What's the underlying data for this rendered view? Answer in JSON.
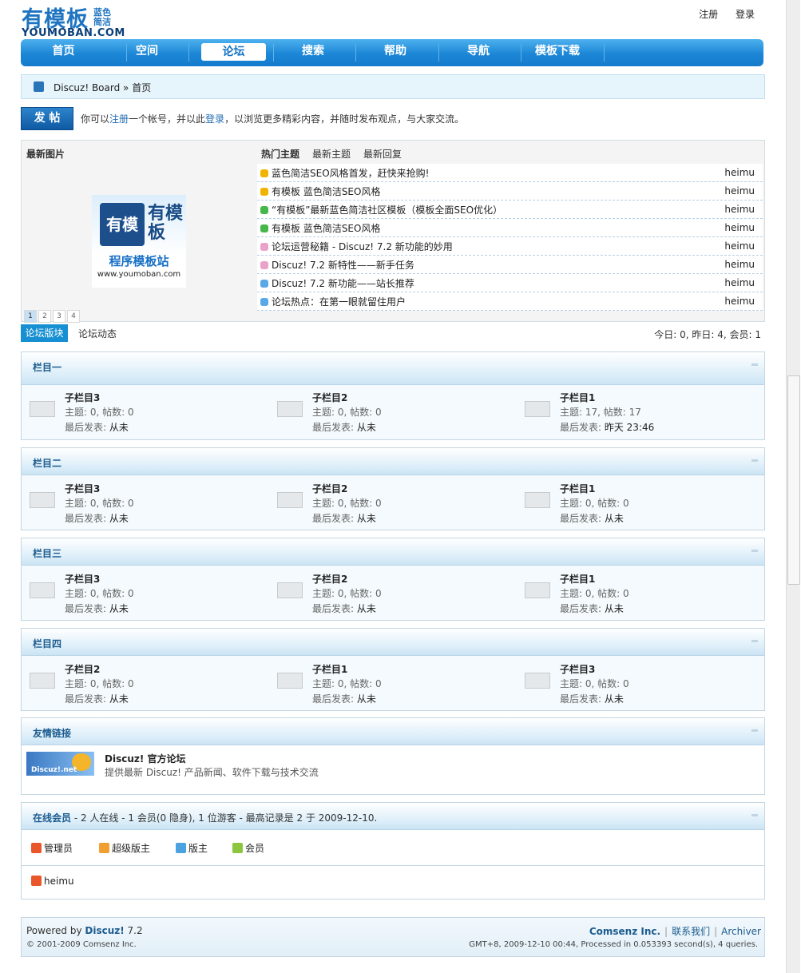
{
  "header": {
    "logo_cn": "有模板",
    "logo_sub1": "蓝色",
    "logo_sub2": "简洁",
    "logo_en": "YOUMOBAN.COM",
    "register": "注册",
    "login": "登录"
  },
  "nav": [
    "首页",
    "空间",
    "论坛",
    "搜索",
    "帮助",
    "导航",
    "模板下载"
  ],
  "nav_active": "论坛",
  "breadcrumb": "Discuz! Board » 首页",
  "post_button": "发 帖",
  "intro": {
    "pre": "你可以",
    "reg": "注册",
    "mid": "一个帐号，并以此",
    "login": "登录",
    "post": "，以浏览更多精彩内容，并随时发布观点，与大家交流。"
  },
  "latest_pics": {
    "title": "最新图片",
    "image_cube": "有模板",
    "image_big": "有模板",
    "image_caption": "程序模板站",
    "image_url": "www.youmoban.com",
    "pages": [
      "1",
      "2",
      "3",
      "4"
    ]
  },
  "topic_tabs": [
    "热门主题",
    "最新主题",
    "最新回复"
  ],
  "topics": [
    {
      "title": "蓝色简洁SEO风格首发，赶快来抢购!",
      "author": "heimu",
      "color": "#f0b400"
    },
    {
      "title": "有模板  蓝色简洁SEO风格",
      "author": "heimu",
      "color": "#f0b400"
    },
    {
      "title": "“有模板”最新蓝色简洁社区模板（模板全面SEO优化）",
      "author": "heimu",
      "color": "#46b84a"
    },
    {
      "title": "有模板  蓝色简洁SEO风格",
      "author": "heimu",
      "color": "#46b84a"
    },
    {
      "title": "论坛运营秘籍  - Discuz! 7.2 新功能的妙用",
      "author": "heimu",
      "color": "#e9a2c8"
    },
    {
      "title": "Discuz! 7.2 新特性——新手任务",
      "author": "heimu",
      "color": "#e9a2c8"
    },
    {
      "title": "Discuz! 7.2 新功能——站长推荐",
      "author": "heimu",
      "color": "#5aa8e6"
    },
    {
      "title": "论坛热点：在第一眼就留住用户",
      "author": "heimu",
      "color": "#5aa8e6"
    }
  ],
  "forum_tabs": [
    "论坛版块",
    "论坛动态"
  ],
  "stats": "今日: 0, 昨日: 4, 会员: 1",
  "groups": [
    {
      "title": "栏目一",
      "subs": [
        {
          "name": "子栏目3",
          "stats": "主题: 0, 帖数: 0",
          "last_label": "最后发表: ",
          "last": "从未"
        },
        {
          "name": "子栏目2",
          "stats": "主题: 0, 帖数: 0",
          "last_label": "最后发表: ",
          "last": "从未"
        },
        {
          "name": "子栏目1",
          "stats": "主题: 17, 帖数: 17",
          "last_label": "最后发表: ",
          "last": "昨天 23:46"
        }
      ]
    },
    {
      "title": "栏目二",
      "subs": [
        {
          "name": "子栏目3",
          "stats": "主题: 0, 帖数: 0",
          "last_label": "最后发表: ",
          "last": "从未"
        },
        {
          "name": "子栏目2",
          "stats": "主题: 0, 帖数: 0",
          "last_label": "最后发表: ",
          "last": "从未"
        },
        {
          "name": "子栏目1",
          "stats": "主题: 0, 帖数: 0",
          "last_label": "最后发表: ",
          "last": "从未"
        }
      ]
    },
    {
      "title": "栏目三",
      "subs": [
        {
          "name": "子栏目3",
          "stats": "主题: 0, 帖数: 0",
          "last_label": "最后发表: ",
          "last": "从未"
        },
        {
          "name": "子栏目2",
          "stats": "主题: 0, 帖数: 0",
          "last_label": "最后发表: ",
          "last": "从未"
        },
        {
          "name": "子栏目1",
          "stats": "主题: 0, 帖数: 0",
          "last_label": "最后发表: ",
          "last": "从未"
        }
      ]
    },
    {
      "title": "栏目四",
      "subs": [
        {
          "name": "子栏目2",
          "stats": "主题: 0, 帖数: 0",
          "last_label": "最后发表: ",
          "last": "从未"
        },
        {
          "name": "子栏目1",
          "stats": "主题: 0, 帖数: 0",
          "last_label": "最后发表: ",
          "last": "从未"
        },
        {
          "name": "子栏目3",
          "stats": "主题: 0, 帖数: 0",
          "last_label": "最后发表: ",
          "last": "从未"
        }
      ]
    }
  ],
  "links": {
    "title": "友情链接",
    "logo_text": "Discuz!.net",
    "name": "Discuz! 官方论坛",
    "desc": "提供最新 Discuz! 产品新闻、软件下载与技术交流"
  },
  "online": {
    "title": "在线会员",
    "summary": " - 2 人在线  - 1 会员(0 隐身), 1 位游客  - 最高记录是  2 于  2009-12-10.",
    "legend": [
      {
        "label": "管理员",
        "color": "#e8562a"
      },
      {
        "label": "超级版主",
        "color": "#f0a030"
      },
      {
        "label": "版主",
        "color": "#4aa3e0"
      },
      {
        "label": "会员",
        "color": "#8cc63e"
      }
    ],
    "users": [
      "heimu"
    ]
  },
  "footer": {
    "powered": "Powered by ",
    "product": "Discuz!",
    "version": " 7.2",
    "copyright": "© 2001-2009 Comsenz Inc.",
    "company": "Comsenz Inc.",
    "contact": "联系我们",
    "archiver": "Archiver",
    "sep": "|",
    "runtime": "GMT+8, 2009-12-10 00:44, Processed in 0.053393 second(s), 4 queries."
  }
}
